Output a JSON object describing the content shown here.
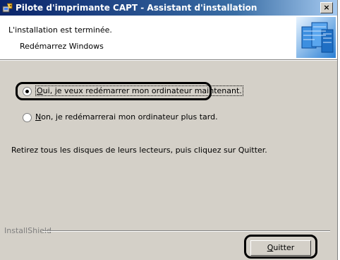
{
  "window": {
    "title": "Pilote d'imprimante CAPT - Assistant d'installation",
    "close_glyph": "×",
    "title_icon": "installer-icon"
  },
  "header": {
    "title": "L'installation est terminée.",
    "subtitle": "Redémarrez Windows",
    "graphic": "computer-graphic-icon"
  },
  "options": {
    "restart_now": {
      "checked": true,
      "mnemonic": "O",
      "label_rest": "ui, je veux redémarrer mon ordinateur maintenant."
    },
    "restart_later": {
      "checked": false,
      "mnemonic": "N",
      "label_rest": "on, je redémarrerai mon ordinateur plus tard."
    }
  },
  "instructions": "Retirez tous les disques de leurs lecteurs, puis cliquez sur Quitter.",
  "footer": {
    "brand": "InstallShield",
    "quit_mnemonic": "Q",
    "quit_rest": "uitter"
  }
}
